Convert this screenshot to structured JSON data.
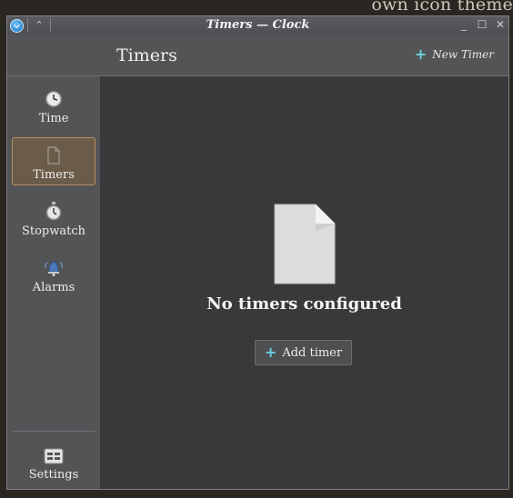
{
  "background_text": "own icon theme",
  "window": {
    "title": "Timers — Clock"
  },
  "titlebar_icons": {
    "app": "app-menu-icon",
    "shade": "keep-above-icon",
    "minimize": "minimize-icon",
    "maximize": "maximize-icon",
    "close": "close-icon"
  },
  "sidebar": {
    "items": [
      {
        "label": "Time",
        "icon": "clock-icon"
      },
      {
        "label": "Timers",
        "icon": "document-icon",
        "active": true
      },
      {
        "label": "Stopwatch",
        "icon": "stopwatch-icon"
      },
      {
        "label": "Alarms",
        "icon": "alarm-bell-icon"
      }
    ],
    "settings": {
      "label": "Settings",
      "icon": "settings-icon"
    }
  },
  "header": {
    "title": "Timers",
    "new_timer_label": "New Timer"
  },
  "main": {
    "empty_message": "No timers configured",
    "add_button_label": "Add timer"
  },
  "colors": {
    "accent": "#69d0de",
    "active_border": "#b7915f",
    "window_bg": "#39393b"
  }
}
